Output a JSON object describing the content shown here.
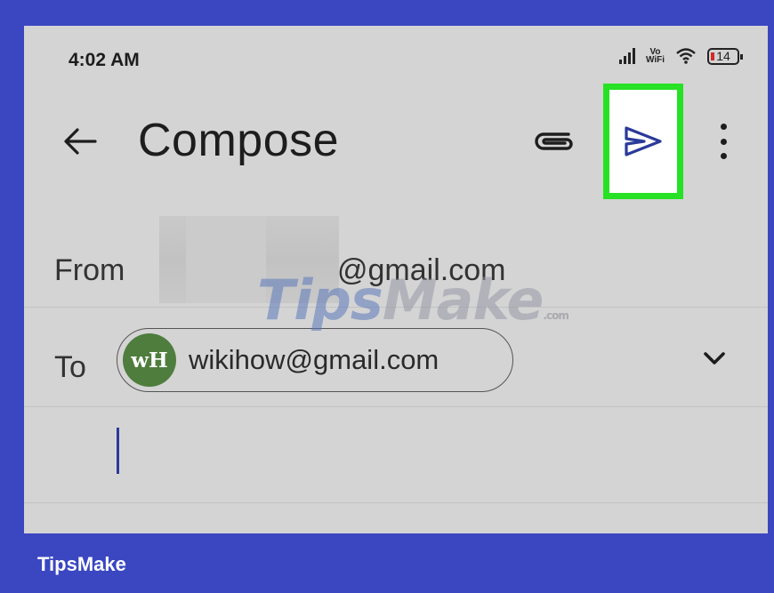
{
  "status_bar": {
    "time": "4:02 AM",
    "network_label": "Vo\nWiFi",
    "battery_level": "14",
    "icons": [
      "signal-icon",
      "vowifi-icon",
      "wifi-icon",
      "battery-icon"
    ]
  },
  "toolbar": {
    "title": "Compose",
    "icons": [
      "back-arrow-icon",
      "attachment-icon",
      "send-icon",
      "more-vert-icon"
    ]
  },
  "from": {
    "label": "From",
    "email_domain": "@gmail.com"
  },
  "to": {
    "label": "To",
    "recipient_initials": "wH",
    "recipient_email": "wikihow@gmail.com"
  },
  "watermark": {
    "part1": "Tips",
    "part2": "Make",
    "suffix": ".com"
  },
  "footer": {
    "brand": "TipsMake"
  },
  "colors": {
    "frame": "#3a47c1",
    "background": "#d4d4d4",
    "highlight": "#27e124",
    "send_icon": "#2a3a9a",
    "avatar": "#4e7d3e"
  }
}
